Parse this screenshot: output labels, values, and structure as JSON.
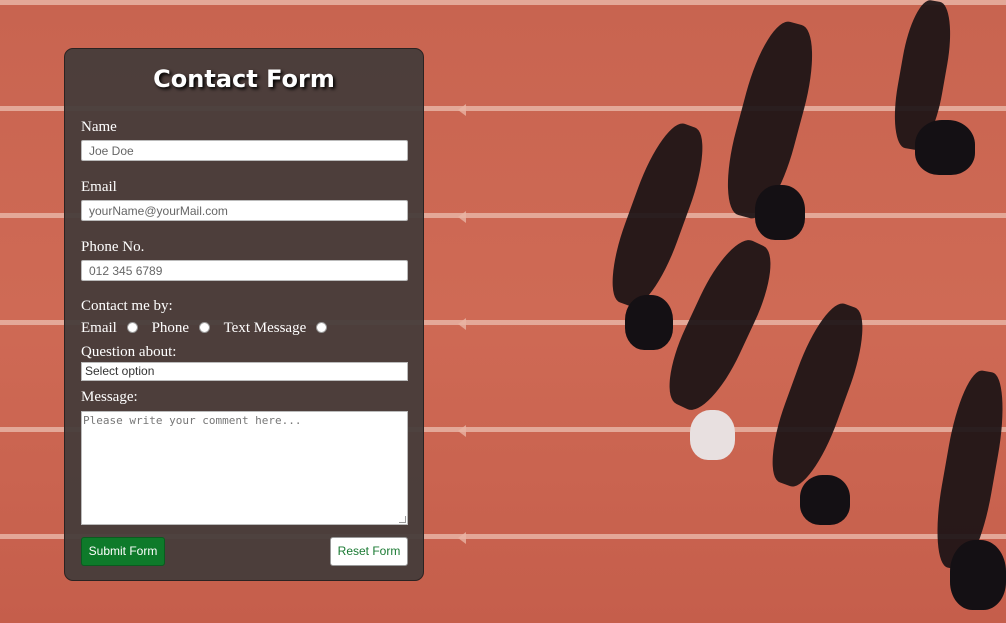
{
  "form": {
    "title": "Contact Form",
    "name_label": "Name",
    "name_placeholder": "Joe Doe",
    "email_label": "Email",
    "email_placeholder": "yourName@yourMail.com",
    "phone_label": "Phone No.",
    "phone_placeholder": "012 345 6789",
    "contact_label": "Contact me by:",
    "contact_options": [
      "Email",
      "Phone",
      "Text Message"
    ],
    "question_label": "Question about:",
    "question_selected": "Select option",
    "message_label": "Message:",
    "message_placeholder": "Please write your comment here...",
    "submit_label": "Submit Form",
    "reset_label": "Reset Form"
  },
  "colors": {
    "card_bg": "#463c3a",
    "submit_bg": "#0e7a2a",
    "reset_text": "#1a7a33",
    "track": "#c86450"
  }
}
